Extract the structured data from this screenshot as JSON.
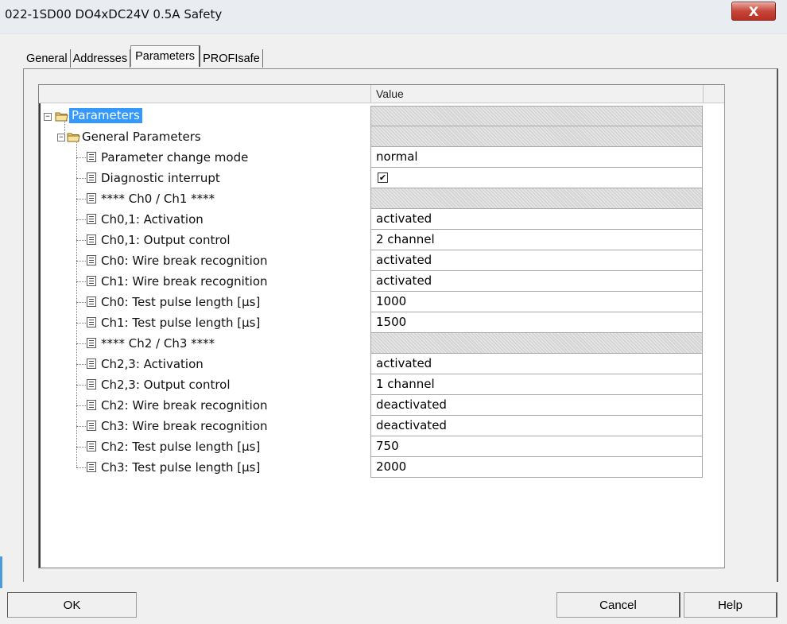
{
  "window": {
    "title": "022-1SD00 DO4xDC24V 0.5A Safety",
    "close_label": "X"
  },
  "tabs": [
    {
      "label": "General",
      "active": false
    },
    {
      "label": "Addresses",
      "active": false
    },
    {
      "label": "Parameters",
      "active": true
    },
    {
      "label": "PROFIsafe",
      "active": false
    }
  ],
  "grid": {
    "column_header": "Value",
    "rows": [
      {
        "name": "Parameters",
        "value": "",
        "type": "root"
      },
      {
        "name": "General Parameters",
        "value": "",
        "type": "group"
      },
      {
        "name": "Parameter change mode",
        "value": "normal",
        "type": "param"
      },
      {
        "name": "Diagnostic interrupt",
        "value": "✔",
        "type": "checkbox"
      },
      {
        "name": "**** Ch0 / Ch1 ****",
        "value": "",
        "type": "separator"
      },
      {
        "name": "Ch0,1: Activation",
        "value": "activated",
        "type": "param"
      },
      {
        "name": "Ch0,1: Output control",
        "value": "2 channel",
        "type": "param"
      },
      {
        "name": "Ch0: Wire break recognition",
        "value": "activated",
        "type": "param"
      },
      {
        "name": "Ch1: Wire break recognition",
        "value": "activated",
        "type": "param"
      },
      {
        "name": "Ch0: Test pulse length [µs]",
        "value": "1000",
        "type": "param"
      },
      {
        "name": "Ch1: Test pulse length [µs]",
        "value": "1500",
        "type": "param"
      },
      {
        "name": "**** Ch2 / Ch3 ****",
        "value": "",
        "type": "separator"
      },
      {
        "name": "Ch2,3: Activation",
        "value": "activated",
        "type": "param"
      },
      {
        "name": "Ch2,3: Output control",
        "value": "1 channel",
        "type": "param"
      },
      {
        "name": "Ch2: Wire break recognition",
        "value": "deactivated",
        "type": "param"
      },
      {
        "name": "Ch3: Wire break recognition",
        "value": "deactivated",
        "type": "param"
      },
      {
        "name": "Ch2: Test pulse length [µs]",
        "value": "750",
        "type": "param"
      },
      {
        "name": "Ch3: Test pulse length [µs]",
        "value": "2000",
        "type": "param"
      }
    ]
  },
  "buttons": {
    "ok": "OK",
    "cancel": "Cancel",
    "help": "Help"
  },
  "colors": {
    "selection": "#3399ff",
    "close": "#c7463a"
  }
}
